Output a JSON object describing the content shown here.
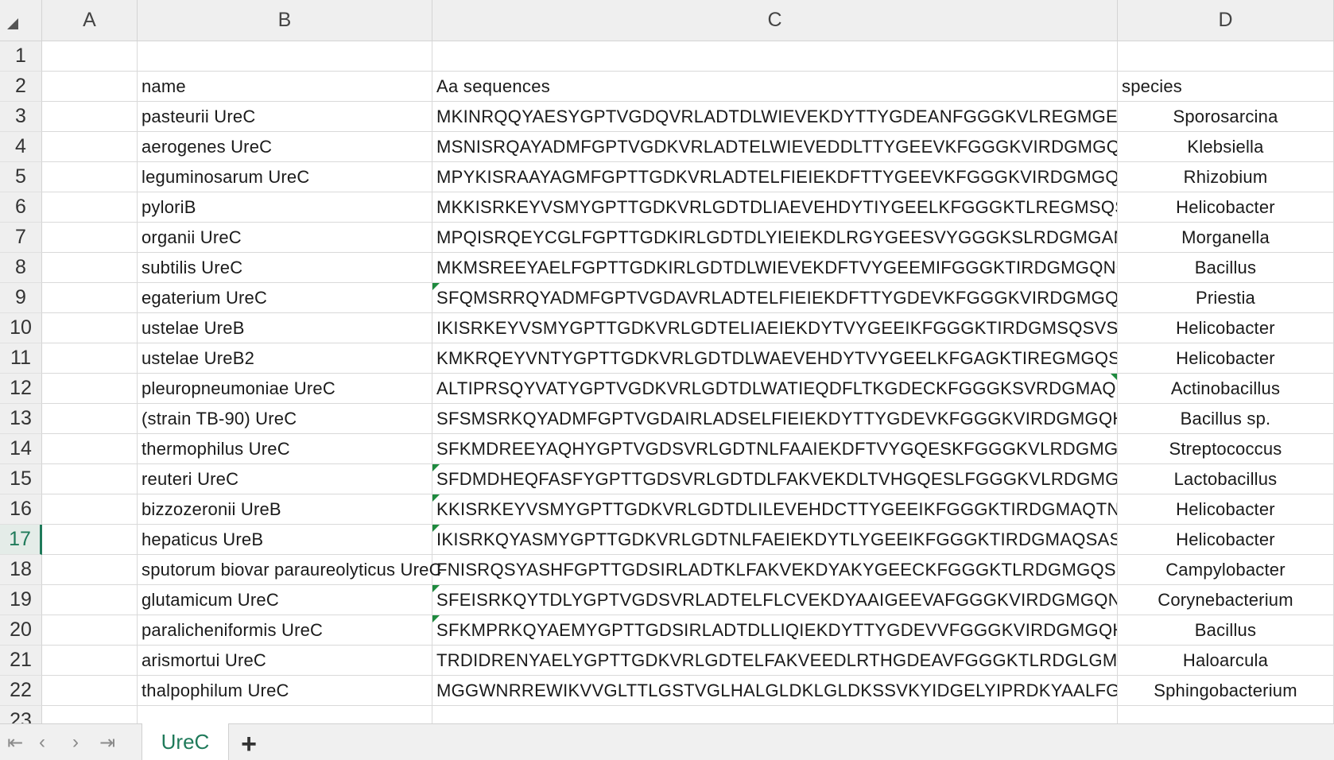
{
  "columns": [
    "A",
    "B",
    "C",
    "D"
  ],
  "row_numbers": [
    "1",
    "2",
    "3",
    "4",
    "5",
    "6",
    "7",
    "8",
    "9",
    "10",
    "11",
    "12",
    "13",
    "14",
    "15",
    "16",
    "17",
    "18",
    "19",
    "20",
    "21",
    "22",
    "23"
  ],
  "active_row": "17",
  "headers": {
    "name": "name",
    "seq": "Aa sequences",
    "species": "species"
  },
  "rows": [
    {
      "name": "pasteurii UreC",
      "seq": "MKINRQQYAESYGPTVGDQVRLADTDLWIEVEKDYTTYGDEANFGGGKVLREGMGENG",
      "species": "Sporosarcina",
      "flag": false
    },
    {
      "name": "aerogenes UreC",
      "seq": "MSNISRQAYADMFGPTVGDKVRLADTELWIEVEDDLTTYGEEVKFGGGKVIRDGMGQG",
      "species": "Klebsiella",
      "flag": false
    },
    {
      "name": "leguminosarum UreC",
      "seq": "MPYKISRAAYAGMFGPTTGDKVRLADTELFIEIEKDFTTYGEEVKFGGGKVIRDGMGQSG",
      "species": "Rhizobium",
      "flag": false
    },
    {
      "name": "pyloriB",
      "seq": "MKKISRKEYVSMYGPTTGDKVRLGDTDLIAEVEHDYTIYGEELKFGGGKTLREGMSQSNN",
      "species": "Helicobacter",
      "flag": false
    },
    {
      "name": "organii UreC",
      "seq": "MPQISRQEYCGLFGPTTGDKIRLGDTDLYIEIEKDLRGYGEESVYGGGKSLRDGMGANNTI",
      "species": "Morganella",
      "flag": false
    },
    {
      "name": "subtilis UreC",
      "seq": "MKMSREEYAELFGPTTGDKIRLGDTDLWIEVEKDFTVYGEEMIFGGGKTIRDGMGQNGRIT",
      "species": "Bacillus",
      "flag": false
    },
    {
      "name": "egaterium UreC",
      "seq": "SFQMSRRQYADMFGPTVGDAVRLADTELFIEIEKDFTTYGDEVKFGGGKVIRDGMGQHP",
      "species": "Priestia",
      "flag": true
    },
    {
      "name": "ustelae UreB",
      "seq": "IKISRKEYVSMYGPTTGDKVRLGDTELIAEIEKDYTVYGEEIKFGGGKTIRDGMSQSVSPDV",
      "species": "Helicobacter",
      "flag": false
    },
    {
      "name": "ustelae UreB2",
      "seq": "KMKRQEYVNTYGPTTGDKVRLGDTDLWAEVEHDYTVYGEELKFGAGKTIREGMGQSNS",
      "species": "Helicobacter",
      "flag": false
    },
    {
      "name": "pleuropneumoniae UreC",
      "seq": "ALTIPRSQYVATYGPTVGDKVRLGDTDLWATIEQDFLTKGDECKFGGGKSVRDGMAQS",
      "species": "Actinobacillus",
      "flag": false,
      "flag_right": true
    },
    {
      "name": "(strain TB-90) UreC",
      "seq": "SFSMSRKQYADMFGPTVGDAIRLADSELFIEIEKDYTTYGDEVKFGGGKVIRDGMGQHPL",
      "species": "Bacillus sp.",
      "flag": false
    },
    {
      "name": "thermophilus UreC",
      "seq": "SFKMDREEYAQHYGPTVGDSVRLGDTNLFAAIEKDFTVYGQESKFGGGKVLRDGMGVS",
      "species": "Streptococcus",
      "flag": false
    },
    {
      "name": "reuteri UreC",
      "seq": "SFDMDHEQFASFYGPTTGDSVRLGDTDLFAKVEKDLTVHGQESLFGGGKVLRDGMGVS",
      "species": "Lactobacillus",
      "flag": true
    },
    {
      "name": "bizzozeronii UreB",
      "seq": "KKISRKEYVSMYGPTTGDKVRLGDTDLILEVEHDCTTYGEEIKFGGGKTIRDGMAQTNSPS",
      "species": "Helicobacter",
      "flag": true
    },
    {
      "name": "hepaticus UreB",
      "seq": "IKISRKQYASMYGPTTGDKVRLGDTNLFAEIEKDYTLYGEEIKFGGGKTIRDGMAQSAST",
      "species": "Helicobacter",
      "flag": true
    },
    {
      "name": "sputorum biovar paraureolyticus UreC",
      "seq": "FNISRQSYASHFGPTTGDSIRLADTKLFAKVEKDYAKYGEECKFGGGKTLRDGMGQSSR",
      "species": "Campylobacter",
      "flag": false
    },
    {
      "name": "glutamicum UreC",
      "seq": "SFEISRKQYTDLYGPTVGDSVRLADTELFLCVEKDYAAIGEEVAFGGGKVIRDGMGQNGT",
      "species": "Corynebacterium",
      "flag": true
    },
    {
      "name": "paralicheniformis UreC",
      "seq": "SFKMPRKQYAEMYGPTTGDSIRLADTDLLIQIEKDYTTYGDEVVFGGGKVIRDGMGQHPI",
      "species": "Bacillus",
      "flag": true
    },
    {
      "name": "arismortui UreC",
      "seq": "TRDIDRENYAELYGPTTGDKVRLGDTELFAKVEEDLRTHGDEAVFGGGKTLRDGLGMAPG",
      "species": "Haloarcula",
      "flag": false
    },
    {
      "name": "thalpophilum UreC",
      "seq": "MGGWNRREWIKVVGLTTLGSTVGLHALGLDKLGLDKSSVKYIDGELYIPRDKYAALFGP",
      "species": "Sphingobacterium",
      "flag": false
    }
  ],
  "tabs": {
    "sheet_name": "UreC",
    "add_label": "+"
  },
  "nav": {
    "first": "⇤",
    "prev": "‹",
    "next": "›",
    "last": "⇥"
  }
}
